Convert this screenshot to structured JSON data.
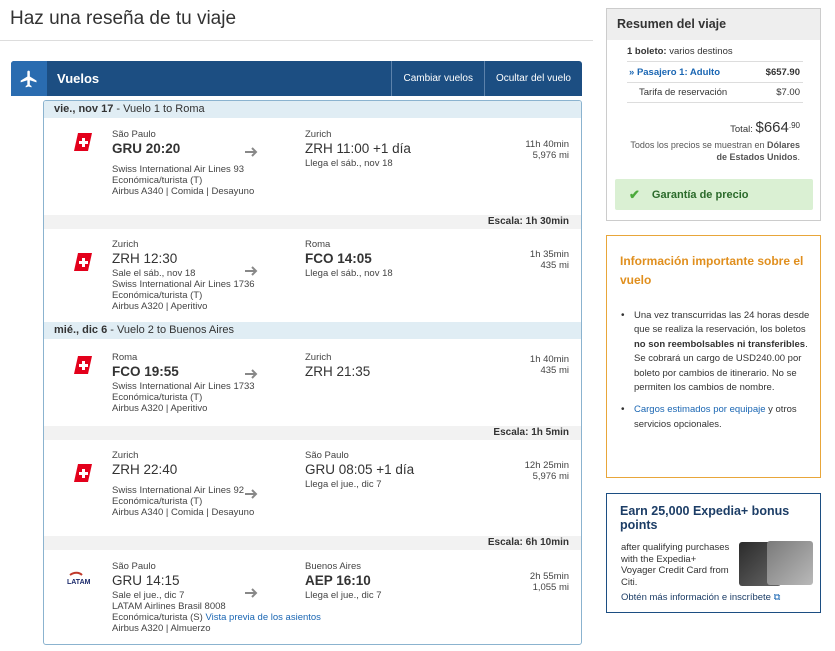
{
  "page": {
    "title": "Haz una reseña de tu viaje"
  },
  "flights": {
    "title": "Vuelos",
    "change_label": "Cambiar vuelos",
    "hide_label": "Ocultar del vuelo"
  },
  "days": [
    {
      "date": "vie., nov 17",
      "label": " - Vuelo 1 to Roma"
    },
    {
      "date": "mié., dic 6",
      "label": " - Vuelo 2 to Buenos Aires"
    }
  ],
  "segments": [
    {
      "from_city": "São Paulo",
      "from_time": "GRU 20:20",
      "from_sub": "",
      "to_city": "Zurich",
      "to_time": "ZRH 11:00 +1 día",
      "to_sub": "Llega el sáb., nov 18",
      "airline": "Swiss International Air Lines 93",
      "cabin": "Económica/turista (T)",
      "aircraft": "Airbus A340 | Comida | Desayuno",
      "duration": "11h 40min",
      "distance": "5,976 mi"
    },
    {
      "from_city": "Zurich",
      "from_time": "ZRH 12:30",
      "from_sub": "Sale el sáb., nov 18",
      "to_city": "Roma",
      "to_time": "FCO 14:05",
      "to_sub": "Llega el sáb., nov 18",
      "airline": "Swiss International Air Lines 1736",
      "cabin": "Económica/turista (T)",
      "aircraft": "Airbus A320 | Aperitivo",
      "duration": "1h 35min",
      "distance": "435 mi"
    },
    {
      "from_city": "Roma",
      "from_time": "FCO 19:55",
      "from_sub": "",
      "to_city": "Zurich",
      "to_time": "ZRH 21:35",
      "to_sub": "",
      "airline": "Swiss International Air Lines 1733",
      "cabin": "Económica/turista (T)",
      "aircraft": "Airbus A320 | Aperitivo",
      "duration": "1h 40min",
      "distance": "435 mi"
    },
    {
      "from_city": "Zurich",
      "from_time": "ZRH 22:40",
      "from_sub": "",
      "to_city": "São Paulo",
      "to_time": "GRU 08:05 +1 día",
      "to_sub": "Llega el jue., dic 7",
      "airline": "Swiss International Air Lines 92",
      "cabin": "Económica/turista (T)",
      "aircraft": "Airbus A340 | Comida | Desayuno",
      "duration": "12h 25min",
      "distance": "5,976 mi"
    },
    {
      "from_city": "São Paulo",
      "from_time": "GRU 14:15",
      "from_sub": "Sale el jue., dic 7",
      "to_city": "Buenos Aires",
      "to_time": "AEP 16:10",
      "to_sub": "Llega el jue., dic 7",
      "airline": "LATAM Airlines Brasil 8008",
      "cabin": "Económica/turista (S)",
      "seat_link": "Vista previa de los asientos",
      "aircraft": "Airbus A320 | Almuerzo",
      "duration": "2h 55min",
      "distance": "1,055 mi"
    }
  ],
  "layovers": [
    "Escala: 1h 30min",
    "Escala: 1h 5min",
    "Escala: 6h 10min"
  ],
  "summary": {
    "title": "Resumen del viaje",
    "tickets_bold": "1 boleto:",
    "tickets_rest": " varios destinos",
    "passenger": "Pasajero 1: Adulto",
    "passenger_price": "$657.90",
    "fee_label": "Tarifa de reservación",
    "fee_price": "$7.00",
    "total_label": "Total:",
    "total_main": "$664",
    "total_cents": ".90",
    "currency_note_1": "Todos los precios se muestran en ",
    "currency_note_bold": "Dólares de Estados Unidos",
    "currency_note_2": ".",
    "guarantee": "Garantía de precio"
  },
  "info": {
    "title": "Información importante sobre el vuelo",
    "b1_a": "Una vez transcurridas las 24 horas desde que se realiza la reservación, los boletos ",
    "b1_bold": "no son reembolsables ni transferibles",
    "b1_b": ". Se cobrará un cargo de USD240.00 por boleto por cambios de itinerario. No se permiten los cambios de nombre.",
    "b2_link": "Cargos estimados por equipaje",
    "b2_rest": " y otros servicios opcionales."
  },
  "promo": {
    "title": "Earn 25,000 Expedia+ bonus points",
    "text": "after qualifying purchases with the Expedia+ Voyager Credit Card from Citi.",
    "link": "Obtén más información e inscríbete"
  },
  "colors": {
    "accent": "#1c4e82",
    "swiss_red": "#e3001b",
    "warning": "#e08f1e",
    "success_bg": "#daf0d3"
  }
}
